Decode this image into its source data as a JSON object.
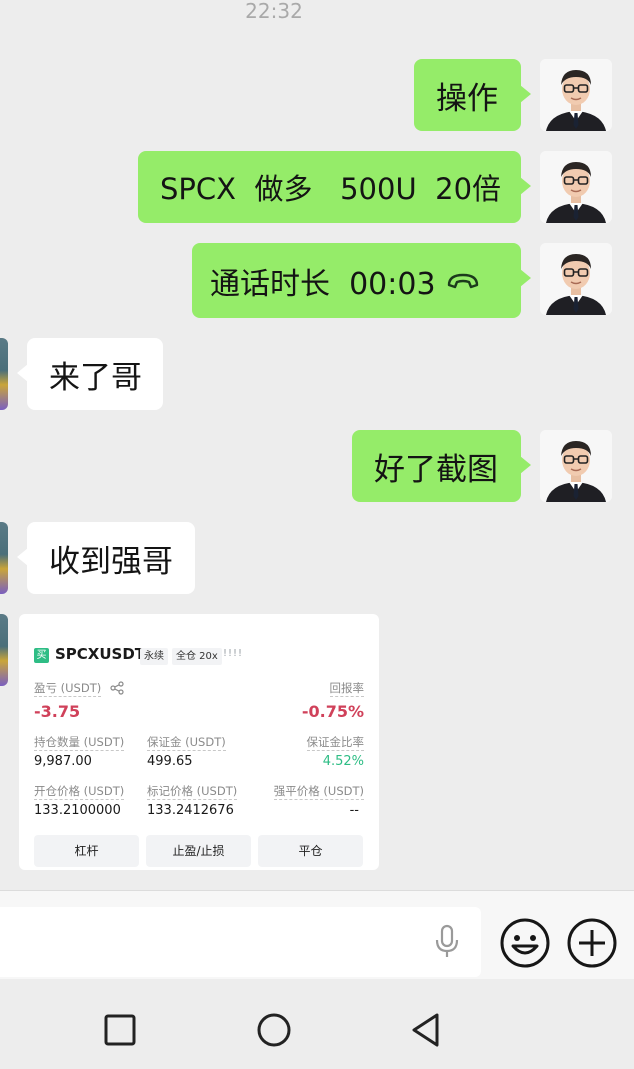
{
  "status": {
    "time": "22:32"
  },
  "messages": [
    {
      "side": "right",
      "text": "操作"
    },
    {
      "side": "right",
      "text": "SPCX  做多   500U  20倍"
    },
    {
      "side": "right",
      "text": "通话时长  00:03",
      "icon": "phone-hangup-icon"
    },
    {
      "side": "left",
      "text": "来了哥"
    },
    {
      "side": "right",
      "text": "好了截图"
    },
    {
      "side": "left",
      "text": "收到强哥"
    }
  ],
  "trade_card": {
    "badge": "买",
    "symbol": "SPCXUSDT",
    "tag_perpetual": "永续",
    "tag_margin": "全仓 20x",
    "signal": "!!!!",
    "pnl_label": "盈亏 (USDT)",
    "pnl_value": "-3.75",
    "roe_label": "回报率",
    "roe_value": "-0.75%",
    "size_label": "持仓数量 (USDT)",
    "size_value": "9,987.00",
    "margin_label": "保证金 (USDT)",
    "margin_value": "499.65",
    "margin_ratio_label": "保证金比率",
    "margin_ratio_value": "4.52%",
    "entry_label": "开仓价格 (USDT)",
    "entry_value": "133.2100000",
    "mark_label": "标记价格 (USDT)",
    "mark_value": "133.2412676",
    "liq_label": "强平价格 (USDT)",
    "liq_value": "--",
    "buttons": [
      "杠杆",
      "止盈/止损",
      "平仓"
    ]
  },
  "colors": {
    "sent_bubble": "#95ec69",
    "received_bubble": "#ffffff",
    "loss": "#d0415a",
    "gain": "#2ebd85",
    "background": "#ededed"
  },
  "icons": [
    "microphone-icon",
    "emoji-icon",
    "plus-icon",
    "back-icon",
    "home-icon",
    "recents-icon",
    "share-icon"
  ]
}
